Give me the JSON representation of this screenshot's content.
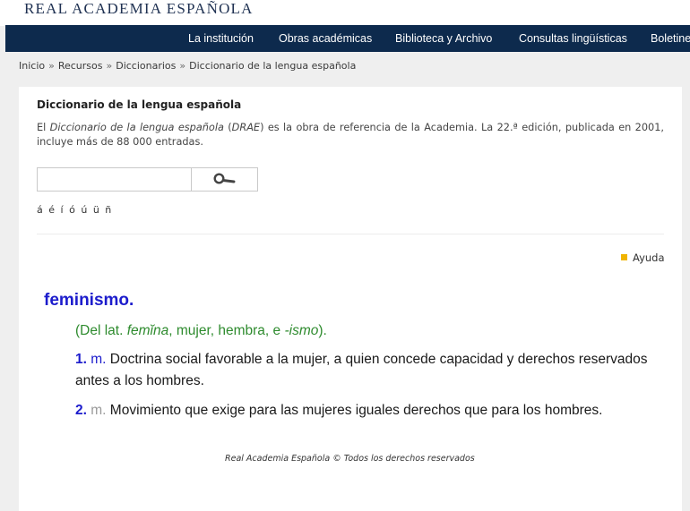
{
  "brand": "REAL ACADEMIA ESPAÑOLA",
  "nav": {
    "items": [
      "La institución",
      "Obras académicas",
      "Biblioteca y Archivo",
      "Consultas lingüísticas",
      "Boletine"
    ]
  },
  "breadcrumb": {
    "items": [
      "Inicio",
      "Recursos",
      "Diccionarios",
      "Diccionario de la lengua española"
    ],
    "separator": "»"
  },
  "panel": {
    "title": "Diccionario de la lengua española",
    "desc_pre": "El ",
    "desc_italic": "Diccionario de la lengua española",
    "desc_mid": " (",
    "desc_abbr": "DRAE",
    "desc_post": ") es la obra de referencia de la Academia. La 22.ª edición, publicada en 2001, incluye más de 88 000 entradas.",
    "search": {
      "value": "",
      "placeholder": ""
    },
    "accents": [
      "á",
      "é",
      "í",
      "ó",
      "ú",
      "ü",
      "ñ"
    ],
    "help_label": "Ayuda"
  },
  "entry": {
    "headword": "feminismo",
    "headword_dot": ".",
    "etym_pre": "(Del lat. ",
    "etym_latin": "femĭna",
    "etym_mid": ", mujer, hembra, e ",
    "etym_suffix": "-ismo",
    "etym_post": ").",
    "senses": [
      {
        "num": "1.",
        "abbr": "m.",
        "text": "Doctrina social favorable a la mujer, a quien concede capacidad y derechos reservados antes a los hombres."
      },
      {
        "num": "2.",
        "abbr": "m.",
        "text": "Movimiento que exige para las mujeres iguales derechos que para los hombres."
      }
    ]
  },
  "footer": "Real Academia Española © Todos los derechos reservados",
  "colors": {
    "nav_bg": "#0d2a4d",
    "headword": "#1c1ccc",
    "etymology": "#2e8b2e",
    "help_square": "#f0b400"
  },
  "icons": {
    "search_button": "magnifier-icon",
    "help": "square-bullet-icon"
  }
}
